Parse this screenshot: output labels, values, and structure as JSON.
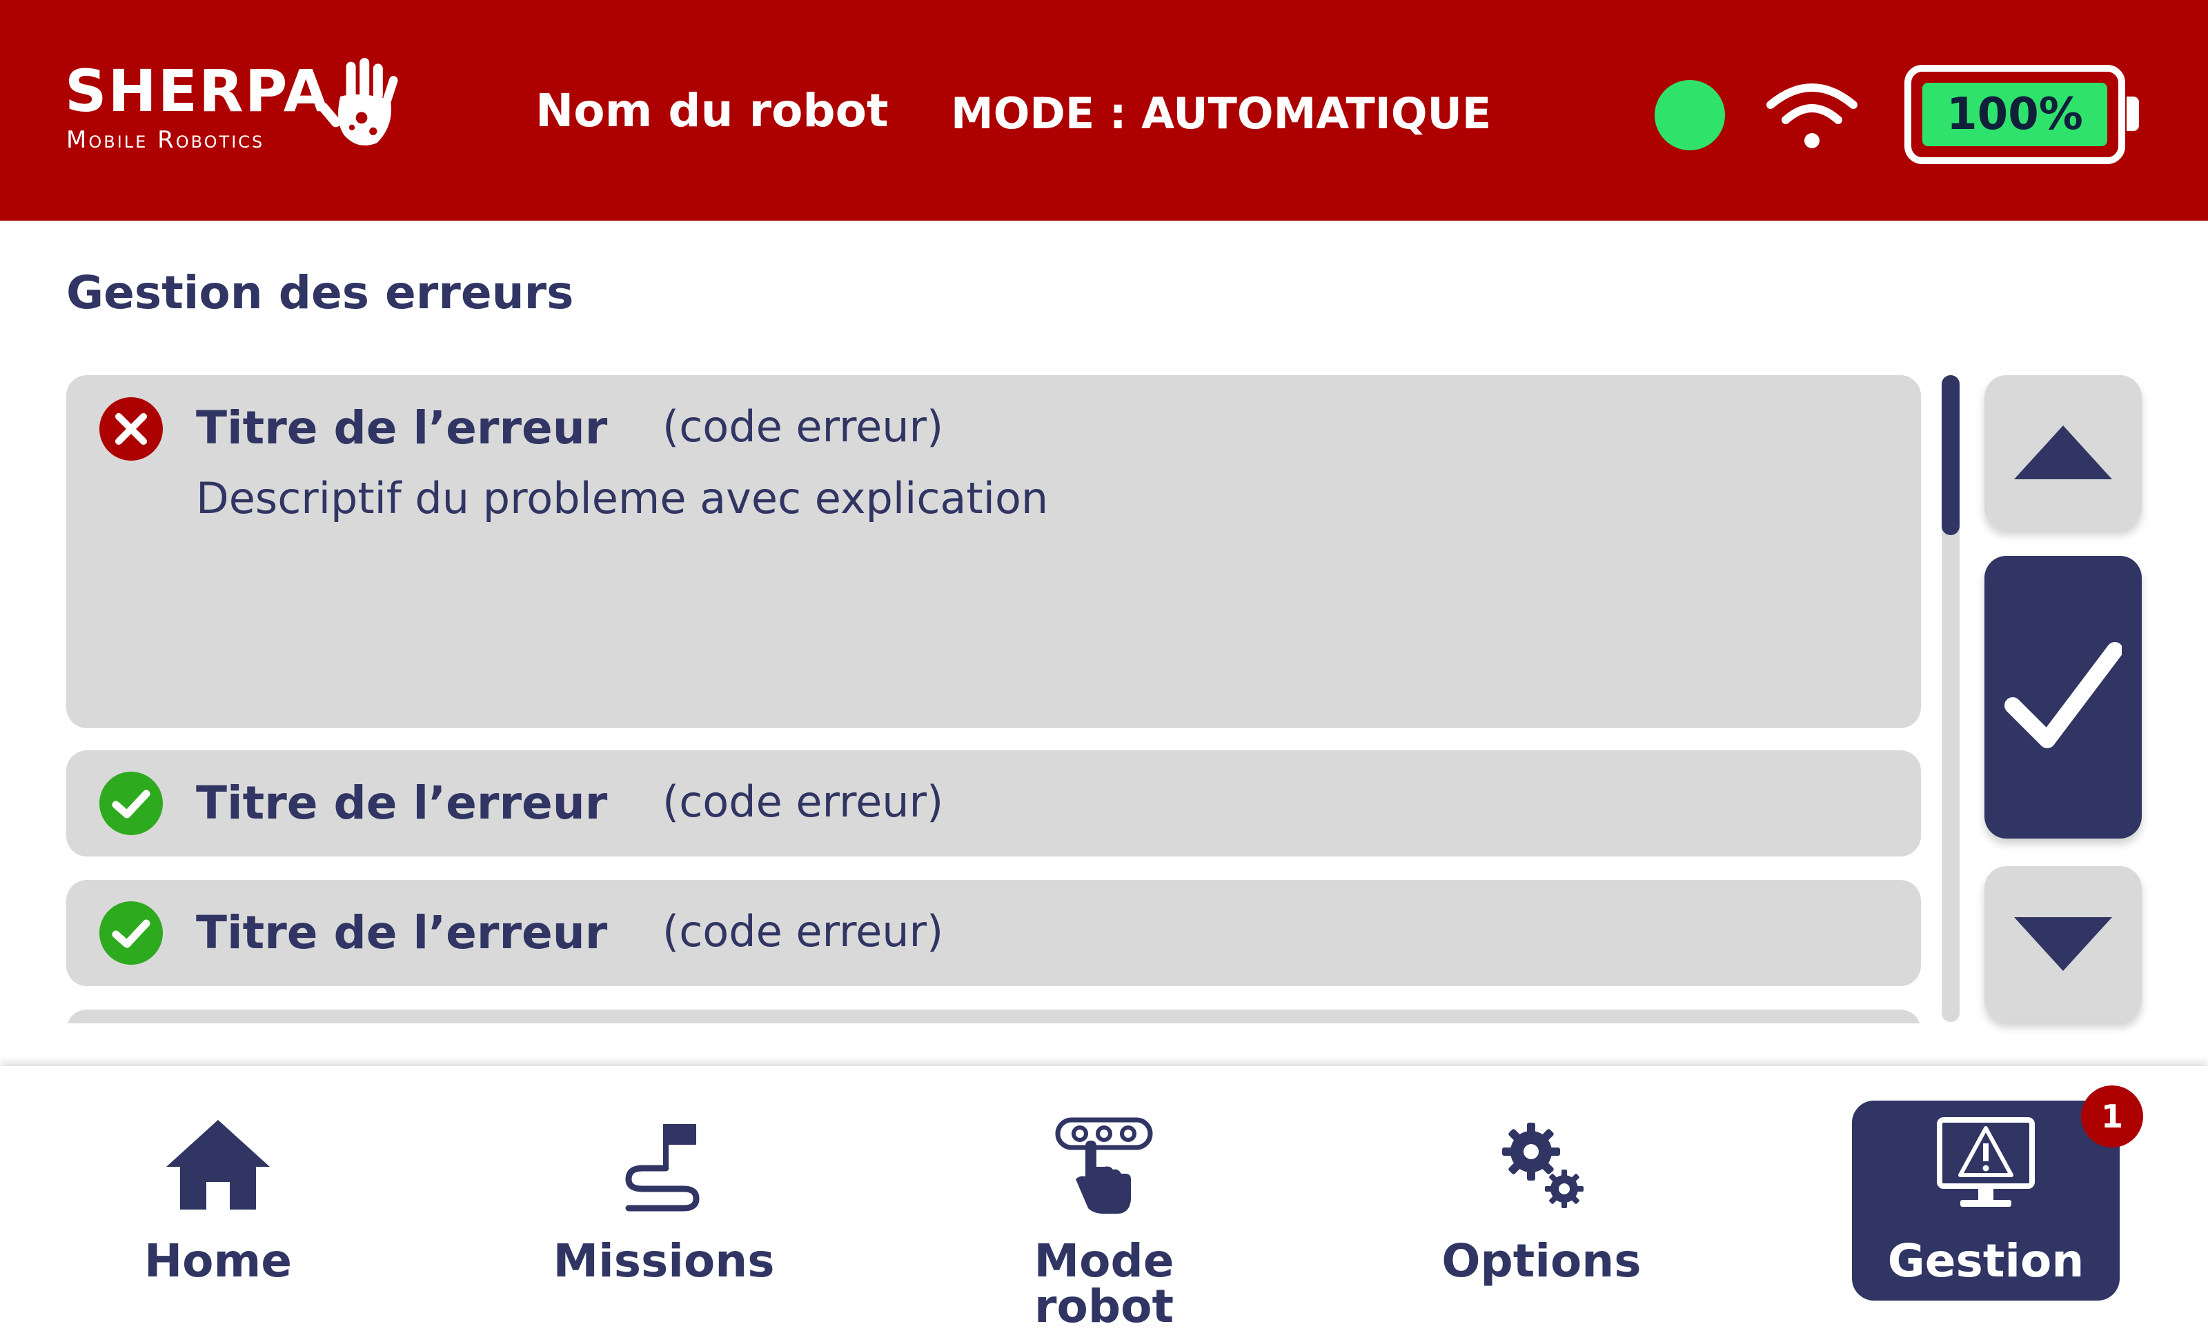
{
  "header": {
    "brand_name": "SHERPA",
    "brand_subtitle": "Mobile Robotics",
    "robot_name": "Nom du robot",
    "mode_text": "MODE : AUTOMATIQUE",
    "battery_label": "100%",
    "battery_level": 1.0,
    "status_color": "#2ee26c",
    "icons": [
      "hand-logo-icon",
      "wifi-icon"
    ]
  },
  "main": {
    "title": "Gestion des erreurs",
    "errors": [
      {
        "status": "error",
        "title": "Titre de l’erreur",
        "code": "(code erreur)",
        "description": "Descriptif du probleme avec explication"
      },
      {
        "status": "resolved",
        "title": "Titre de l’erreur",
        "code": "(code erreur)"
      },
      {
        "status": "resolved",
        "title": "Titre de l’erreur",
        "code": "(code erreur)"
      }
    ],
    "controls": {
      "up_icon": "triangle-up-icon",
      "validate_icon": "checkmark-icon",
      "down_icon": "triangle-down-icon"
    }
  },
  "nav": {
    "items": [
      {
        "label": "Home",
        "icon": "house-icon"
      },
      {
        "label": "Missions",
        "icon": "flag-path-icon"
      },
      {
        "label": "Mode robot",
        "icon": "touch-panel-icon"
      },
      {
        "label": "Options",
        "icon": "gears-icon"
      },
      {
        "label": "Gestion",
        "icon": "monitor-warning-icon",
        "badge": "1",
        "active": true
      }
    ]
  },
  "colors": {
    "header_bg": "#ad0000",
    "primary": "#303563",
    "card_bg": "#d9d9d9",
    "ok_green": "#2eaa1e",
    "error_red": "#ad0000",
    "battery_green": "#2ee26c"
  }
}
